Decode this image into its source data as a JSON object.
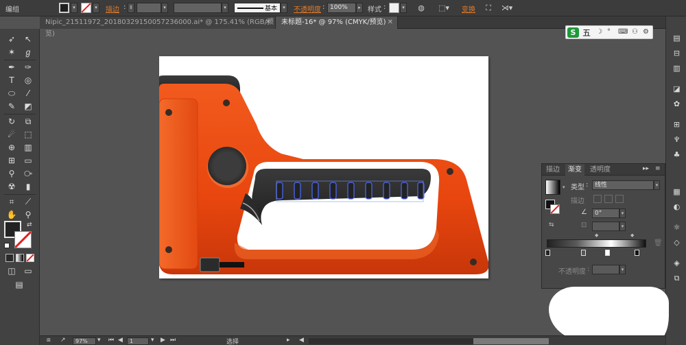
{
  "control_bar": {
    "group_label": "编组",
    "stroke_label": "描边",
    "stroke_style_label": "基本",
    "opacity_label": "不透明度",
    "opacity_value": "100%",
    "style_label": "样式",
    "transform_label": "变换"
  },
  "tabs": [
    {
      "label": "Nipic_21511972_20180329150057236000.ai* @ 175.41% (RGB/预览)",
      "close": "✕"
    },
    {
      "label": "未标题-16* @ 97% (CMYK/预览)",
      "close": "✕"
    }
  ],
  "ime": {
    "brand": "S",
    "mode": "五",
    "icons": [
      "☽",
      "°",
      "⌨",
      "⚇",
      "⚙"
    ]
  },
  "gradient_panel": {
    "tabs": [
      "描边",
      "渐变",
      "透明度"
    ],
    "type_label": "类型",
    "type_value": "线性",
    "stroke_label": "描边",
    "angle_value": "0°",
    "opacity_label": "不透明度"
  },
  "status_bar": {
    "zoom": "97%",
    "page": "1",
    "mode": "选择"
  },
  "colors": {
    "accent": "#e07a2a",
    "stapler_orange": "#e8460e",
    "stapler_dark": "#2a2a2a",
    "path_selection": "#4d6bff"
  }
}
